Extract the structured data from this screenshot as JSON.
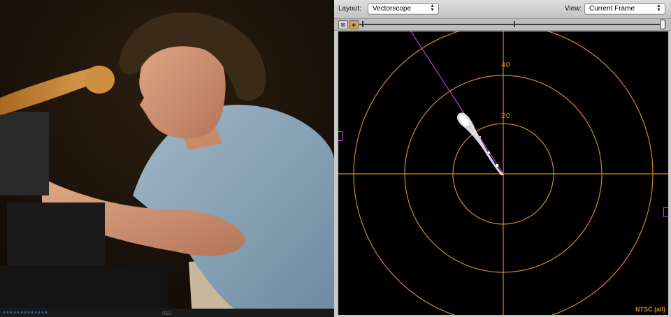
{
  "toolbar": {
    "layout_label": "Layout:",
    "layout_value": "Vectorscope",
    "view_label": "View:",
    "view_value": "Current Frame"
  },
  "controls": {
    "buttons": [
      "zoom-fit",
      "color-toggle"
    ],
    "slider_level": 1.0
  },
  "scope": {
    "ring_labels": [
      "40",
      "20"
    ],
    "standard": "NTSC (all)"
  },
  "viewer": {
    "marker": "010"
  },
  "colors": {
    "graticule": "#d08a1c",
    "skin_tone_line": "#b040e0",
    "panel_bg": "#c9c9c9"
  }
}
